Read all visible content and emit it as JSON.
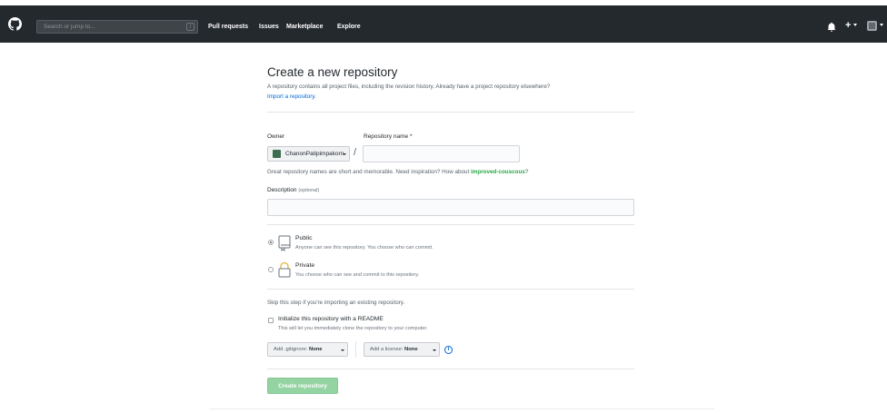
{
  "header": {
    "search_placeholder": "Search or jump to...",
    "search_shortcut": "/",
    "nav": [
      "Pull requests",
      "Issues",
      "Marketplace",
      "Explore"
    ],
    "icons": [
      "github-logo-icon",
      "bell-icon",
      "plus-icon",
      "avatar"
    ]
  },
  "page": {
    "title": "Create a new repository",
    "subtitle": "A repository contains all project files, including the revision history. Already have a project repository elsewhere?",
    "import_link": "Import a repository."
  },
  "form": {
    "owner_label": "Owner",
    "owner_value": "ChanonPatipimpakorn",
    "slash": "/",
    "repo_name_label": "Repository name *",
    "repo_name_value": "",
    "hint_prefix": "Great repository names are short and memorable. Need inspiration? How about ",
    "hint_suggestion": "improved-couscous",
    "hint_suffix": "?",
    "description_label": "Description",
    "description_optional": "(optional)",
    "description_value": "",
    "visibility": [
      {
        "title": "Public",
        "desc": "Anyone can see this repository. You choose who can commit.",
        "selected": true
      },
      {
        "title": "Private",
        "desc": "You choose who can see and commit to this repository.",
        "selected": false
      }
    ],
    "skip_text": "Skip this step if you're importing an existing repository.",
    "readme_label": "Initialize this repository with a README",
    "readme_desc": "This will let you immediately clone the repository to your computer.",
    "readme_checked": false,
    "gitignore_prefix": "Add .gitignore:",
    "gitignore_value": "None",
    "license_prefix": "Add a license:",
    "license_value": "None",
    "info_glyph": "i",
    "submit_label": "Create repository"
  },
  "colors": {
    "header_bg": "#24292e",
    "link": "#0366d6",
    "suggestion": "#28a745",
    "submit_disabled": "#94d3a2"
  }
}
